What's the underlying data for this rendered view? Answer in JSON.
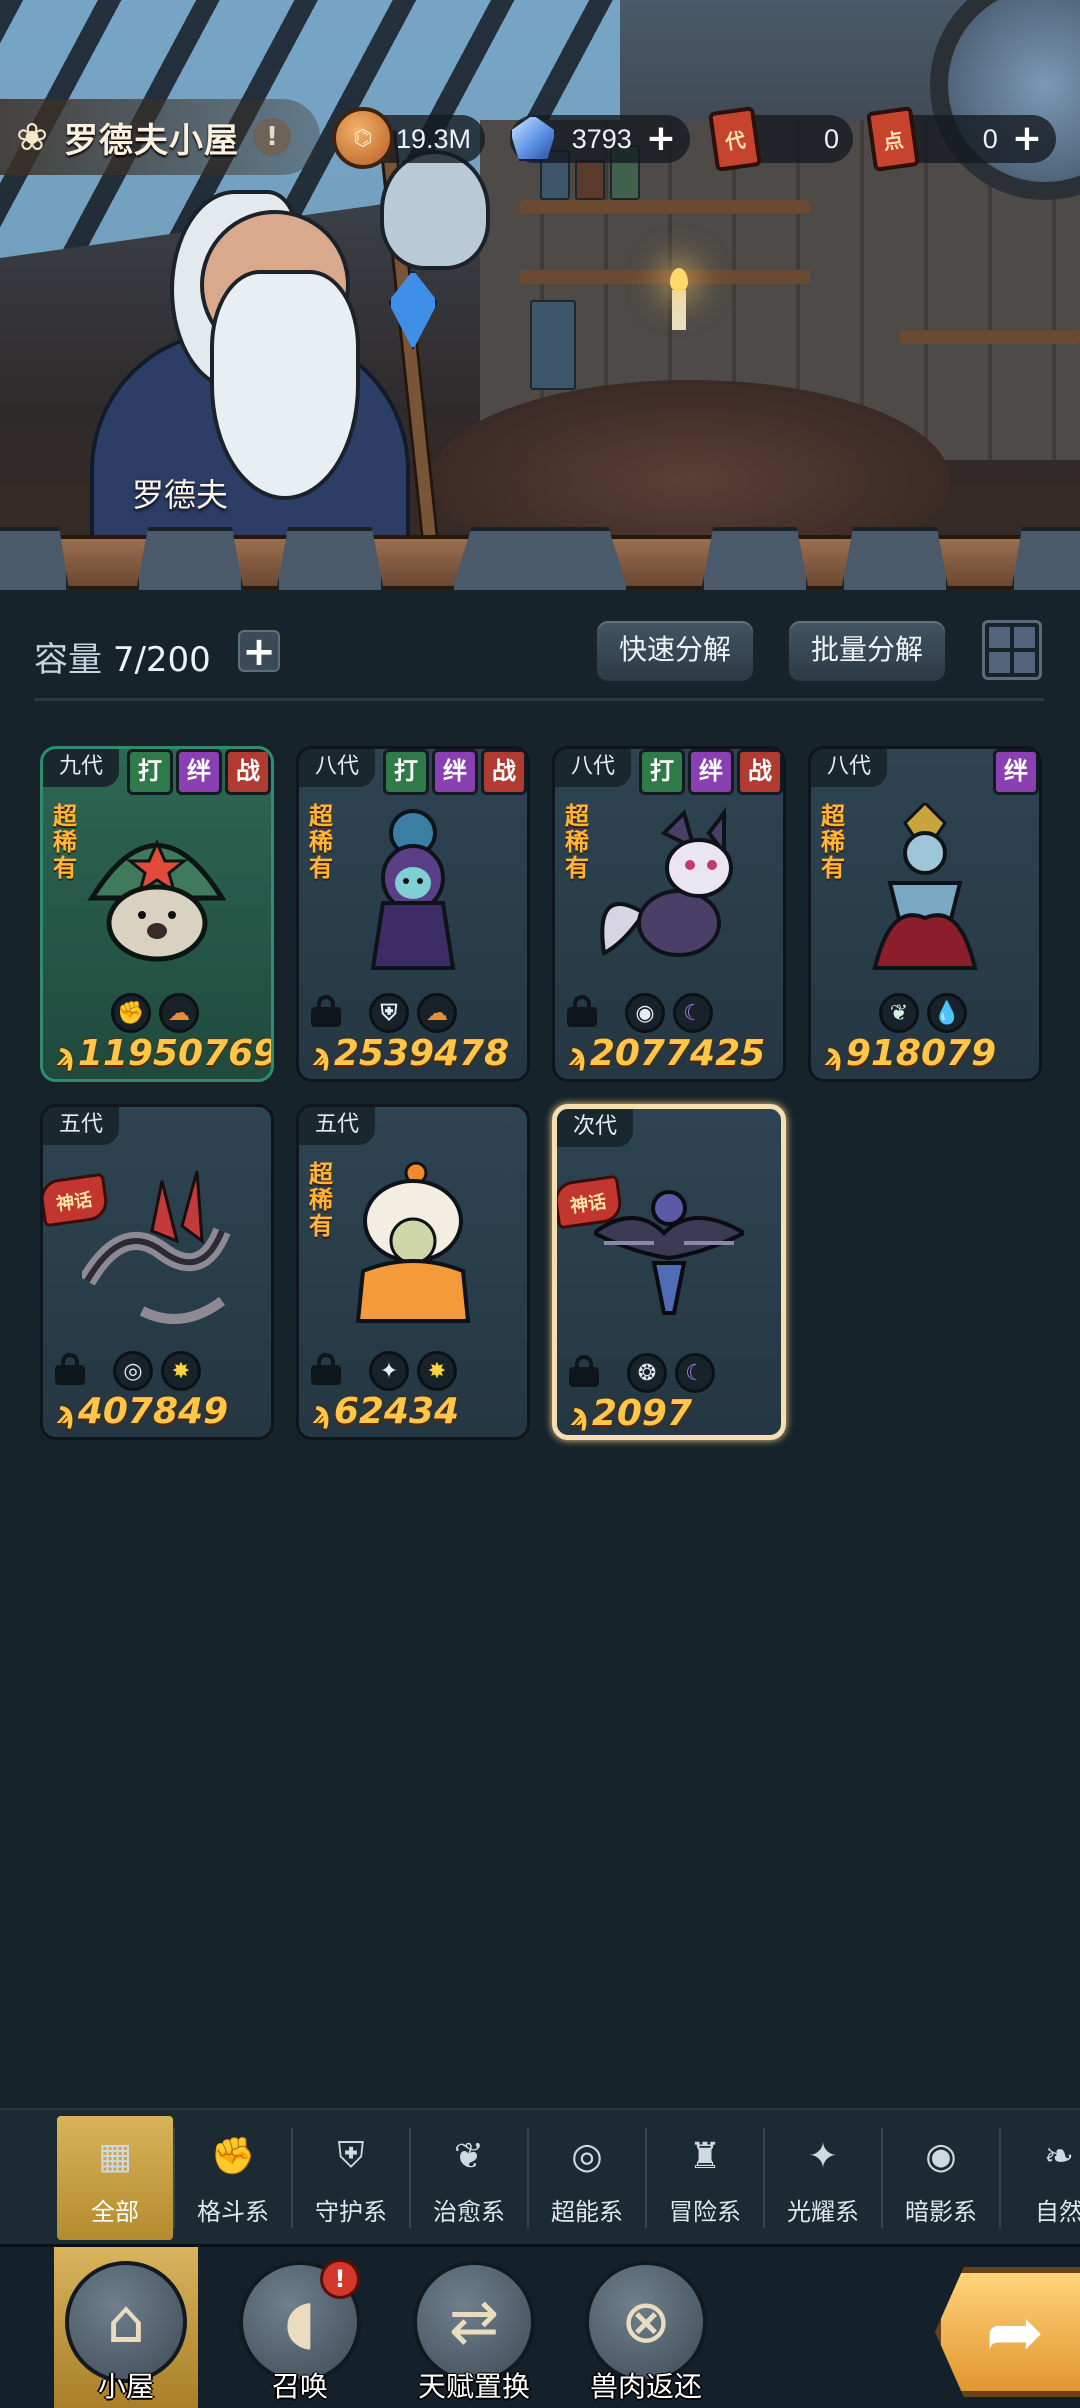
{
  "header": {
    "home_title": "罗德夫小屋",
    "info_icon": "!",
    "npc_name": "罗德夫",
    "resources": [
      {
        "name": "coin",
        "icon": "coin-icon",
        "value": "19.3M",
        "has_plus": false
      },
      {
        "name": "gem",
        "icon": "gem-icon",
        "value": "3793",
        "has_plus": true
      },
      {
        "name": "ticket-dai",
        "icon": "代",
        "value": "0",
        "has_plus": false
      },
      {
        "name": "ticket-dian",
        "icon": "点",
        "value": "0",
        "has_plus": true
      }
    ],
    "plus_symbol": "+"
  },
  "capacity": {
    "label": "容量",
    "value": "7/200",
    "plus": "+",
    "quick_decompose": "快速分解",
    "batch_decompose": "批量分解"
  },
  "cards": [
    {
      "gen": "九代",
      "tags": [
        "打",
        "绊",
        "战"
      ],
      "rarity": "超稀有",
      "legend": "",
      "locked": false,
      "types": [
        "fist",
        "rock"
      ],
      "type_glyphs": [
        "✊",
        "☁"
      ],
      "power": "11950769",
      "style": "green",
      "creature": "mushroom-creature"
    },
    {
      "gen": "八代",
      "tags": [
        "打",
        "绊",
        "战"
      ],
      "rarity": "超稀有",
      "legend": "",
      "locked": true,
      "types": [
        "shield",
        "rock"
      ],
      "type_glyphs": [
        "⛨",
        "☁"
      ],
      "power": "2539478",
      "style": "normal",
      "creature": "rose-dryad-creature"
    },
    {
      "gen": "八代",
      "tags": [
        "打",
        "绊",
        "战"
      ],
      "rarity": "超稀有",
      "legend": "",
      "locked": true,
      "types": [
        "eye",
        "moon"
      ],
      "type_glyphs": [
        "◉",
        "☾"
      ],
      "power": "2077425",
      "style": "normal",
      "creature": "fox-creature"
    },
    {
      "gen": "八代",
      "tags": [
        "绊"
      ],
      "rarity": "超稀有",
      "legend": "",
      "locked": false,
      "types": [
        "leaf",
        "drop"
      ],
      "type_glyphs": [
        "❦",
        "💧"
      ],
      "power": "918079",
      "style": "normal",
      "creature": "crimson-queen-creature"
    },
    {
      "gen": "五代",
      "tags": [],
      "rarity": "",
      "legend": "神话",
      "locked": true,
      "types": [
        "psy",
        "sun"
      ],
      "type_glyphs": [
        "◎",
        "✸"
      ],
      "power": "407849",
      "style": "normal",
      "creature": "bone-dragon-creature"
    },
    {
      "gen": "五代",
      "tags": [],
      "rarity": "超稀有",
      "legend": "",
      "locked": true,
      "types": [
        "star",
        "sun"
      ],
      "type_glyphs": [
        "✦",
        "✸"
      ],
      "power": "62434",
      "style": "normal",
      "creature": "pudding-creature"
    },
    {
      "gen": "次代",
      "tags": [],
      "rarity": "",
      "legend": "神话",
      "locked": true,
      "types": [
        "flame",
        "moon"
      ],
      "type_glyphs": [
        "❂",
        "☾"
      ],
      "power": "2097",
      "style": "selected",
      "creature": "dark-eagle-creature"
    }
  ],
  "filters": [
    {
      "label": "全部",
      "icon": "all-icon",
      "glyph": "▦",
      "active": true
    },
    {
      "label": "格斗系",
      "icon": "fist-icon",
      "glyph": "✊",
      "active": false
    },
    {
      "label": "守护系",
      "icon": "shield-icon",
      "glyph": "⛨",
      "active": false
    },
    {
      "label": "治愈系",
      "icon": "sprout-icon",
      "glyph": "❦",
      "active": false
    },
    {
      "label": "超能系",
      "icon": "psychic-icon",
      "glyph": "◎",
      "active": false
    },
    {
      "label": "冒险系",
      "icon": "adventure-icon",
      "glyph": "♜",
      "active": false
    },
    {
      "label": "光耀系",
      "icon": "light-icon",
      "glyph": "✦",
      "active": false
    },
    {
      "label": "暗影系",
      "icon": "shadow-icon",
      "glyph": "◉",
      "active": false
    },
    {
      "label": "自然",
      "icon": "nature-icon",
      "glyph": "❧",
      "active": false
    }
  ],
  "nav": [
    {
      "label": "小屋",
      "icon": "house-icon",
      "glyph": "⌂",
      "active": true,
      "alert": ""
    },
    {
      "label": "召唤",
      "icon": "egg-icon",
      "glyph": "◖",
      "active": false,
      "alert": "!"
    },
    {
      "label": "天赋置换",
      "icon": "swap-icon",
      "glyph": "⇄",
      "active": false,
      "alert": ""
    },
    {
      "label": "兽肉返还",
      "icon": "meat-icon",
      "glyph": "⊗",
      "active": false,
      "alert": ""
    }
  ],
  "go_glyph": "➦",
  "colors": {
    "background": "#17232b",
    "gold_accent": "#d8b35a",
    "power_text": "#ffc747",
    "rarity_text": "#ffb43a",
    "selected_border": "#f5dfb0"
  }
}
